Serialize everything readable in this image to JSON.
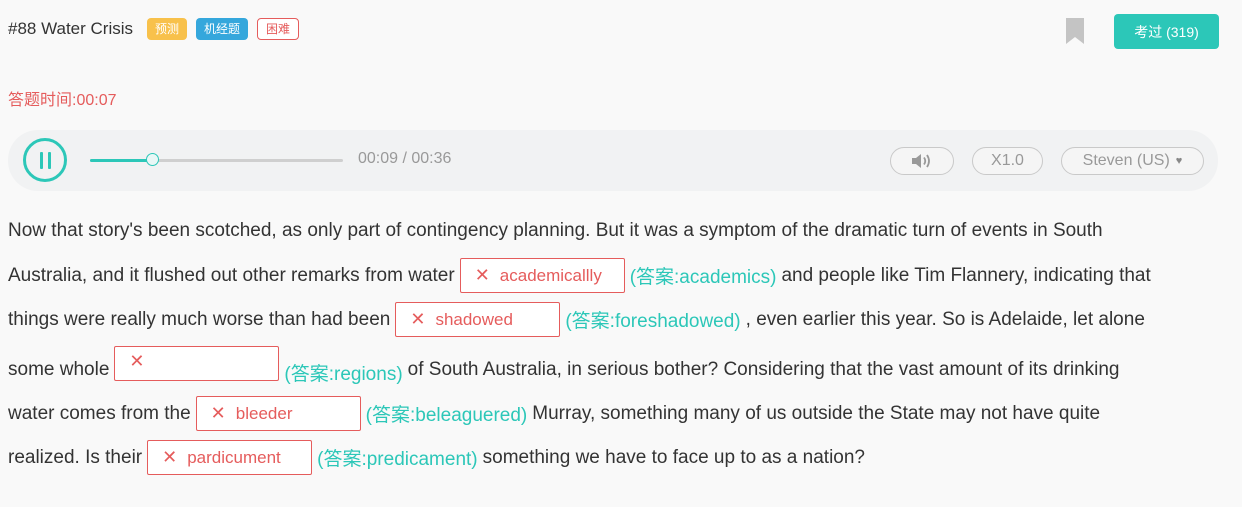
{
  "header": {
    "title": "#88 Water Crisis",
    "tags": [
      {
        "label": "预测",
        "style": "yellow"
      },
      {
        "label": "机经题",
        "style": "blue"
      },
      {
        "label": "困难",
        "style": "red-outline"
      }
    ],
    "bookmark_icon": "bookmark-icon",
    "count_button": "考过 (319)"
  },
  "timer": {
    "label": "答题时间:",
    "value": "00:07"
  },
  "player": {
    "state_icon": "pause-icon",
    "progress": 0.25,
    "current_time": "00:09",
    "total_time": "00:36",
    "time_display": "00:09 / 00:36",
    "volume_icon": "volume-icon",
    "speed": "X1.0",
    "voice": "Steven (US)",
    "voice_caret": "♥"
  },
  "passage": {
    "line1": "Now that story's been scotched, as only part of contingency planning. But it was a symptom of the dramatic turn of events in South",
    "line2_pre": "Australia, and it flushed out other remarks from water",
    "blank1": {
      "user_answer": "academicallly",
      "correct": "(答案:academics)"
    },
    "line2_post": "and people like Tim Flannery, indicating that",
    "line3_pre": "things were really much worse than had been",
    "blank2": {
      "user_answer": "shadowed",
      "correct": "(答案:foreshadowed)"
    },
    "line3_post": ", even earlier this year. So is Adelaide, let alone",
    "line4_pre": "some whole",
    "blank3": {
      "user_answer": "",
      "correct": "(答案:regions)"
    },
    "line4_post": "of South Australia, in serious bother? Considering that the vast amount of its drinking",
    "line5_pre": "water comes from the",
    "blank4": {
      "user_answer": "bleeder",
      "correct": "(答案:beleaguered)"
    },
    "line5_post": "Murray, something many of us outside the State may not have quite",
    "line6_pre": "realized. Is their",
    "blank5": {
      "user_answer": "pardicument",
      "correct": "(答案:predicament)"
    },
    "line6_post": "something we have to face up to as a nation?",
    "wrong_mark": "✕"
  },
  "colors": {
    "accent": "#2cc7b8",
    "error": "#e55c5c",
    "tag_yellow": "#f8c14b",
    "tag_blue": "#35a7dc"
  }
}
